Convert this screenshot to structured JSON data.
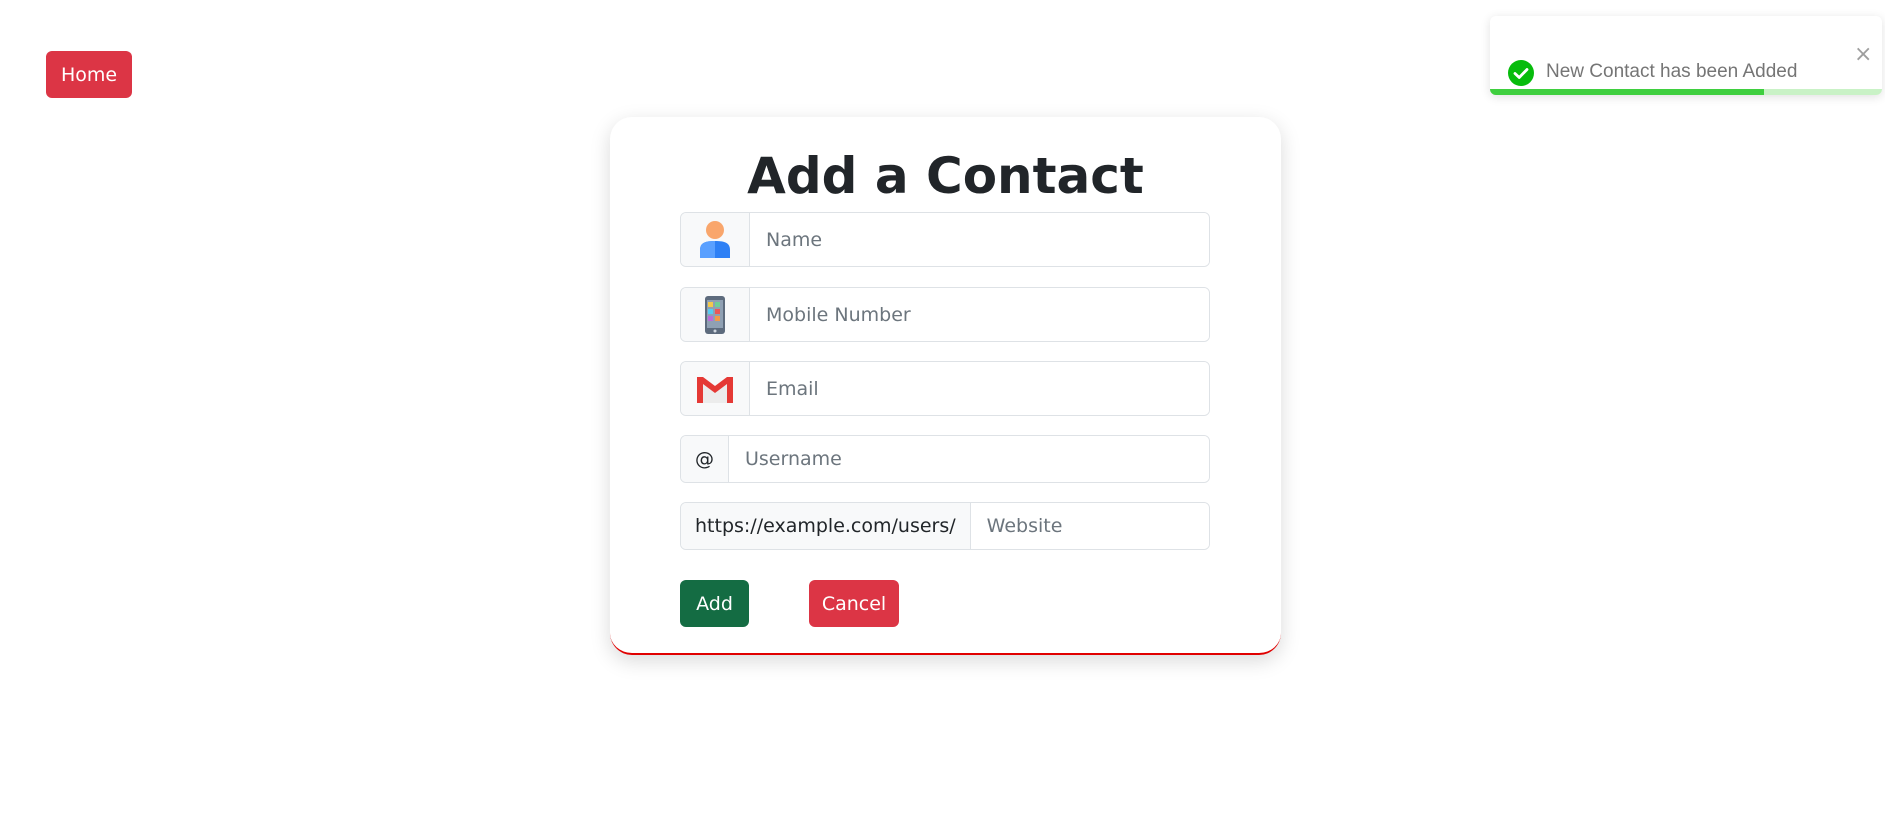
{
  "nav": {
    "home_label": "Home"
  },
  "toast": {
    "message": "New Contact has been Added",
    "close_glyph": "×",
    "icon": "check-circle-icon",
    "progress_fraction": 0.7
  },
  "form": {
    "title": "Add a Contact",
    "fields": {
      "name": {
        "placeholder": "Name",
        "value": "",
        "icon": "person-icon"
      },
      "mobile": {
        "placeholder": "Mobile Number",
        "value": "",
        "icon": "smartphone-icon"
      },
      "email": {
        "placeholder": "Email",
        "value": "",
        "icon": "gmail-icon"
      },
      "username": {
        "prefix": "@",
        "placeholder": "Username",
        "value": ""
      },
      "website": {
        "prefix": "https://example.com/users/",
        "placeholder": "Website",
        "value": ""
      }
    },
    "add_label": "Add",
    "cancel_label": "Cancel"
  },
  "colors": {
    "danger": "#dc3545",
    "success": "#146c43",
    "toast_success": "#07bc0c",
    "toast_progress": "#3fcf3f",
    "card_accent": "#e00000"
  }
}
